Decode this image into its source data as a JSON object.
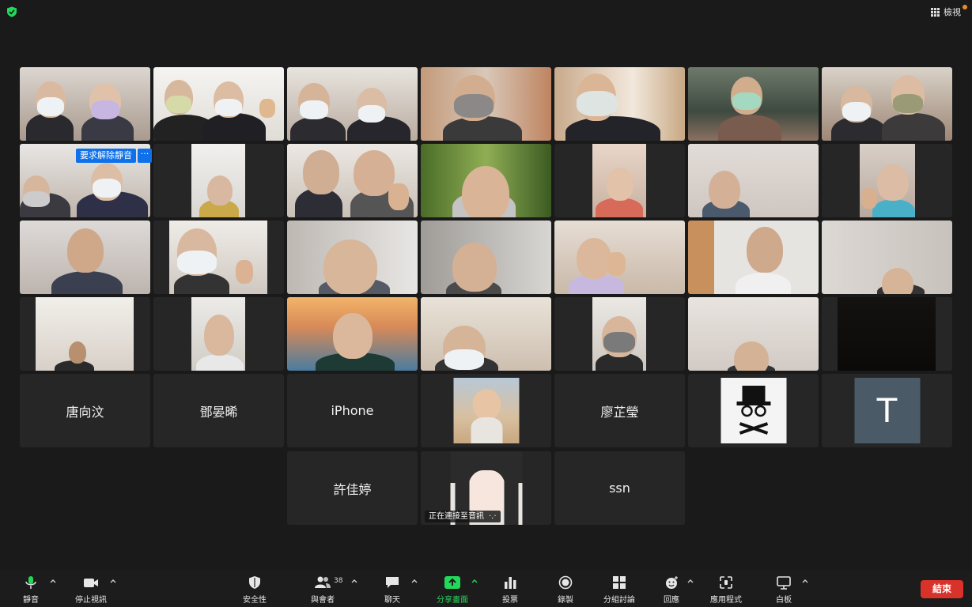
{
  "top_bar": {
    "view_label": "檢視"
  },
  "colors": {
    "active_speaker": "#23d959",
    "share_green": "#23d959",
    "end_red": "#d9322a",
    "request_blue": "#0e71eb"
  },
  "unmute_request": {
    "label": "要求解除靜音",
    "more": "···"
  },
  "name_tiles": {
    "t1": "唐向汶",
    "t2": "鄧晏晞",
    "t3": "iPhone",
    "t4": "廖芷瑩",
    "t5": "T",
    "t6": "許佳婷",
    "t7": "ssn"
  },
  "connecting_label": {
    "text": "正在連接至音訊",
    "dots": "·.·"
  },
  "toolbar": {
    "mute": "靜音",
    "stop_video": "停止視訊",
    "security": "安全性",
    "participants": "與會者",
    "participant_count": "38",
    "chat": "聊天",
    "share_screen": "分享畫面",
    "polls": "投票",
    "record": "錄製",
    "breakout": "分組討論",
    "reactions": "回應",
    "apps": "應用程式",
    "whiteboard": "白板",
    "end": "結束"
  }
}
